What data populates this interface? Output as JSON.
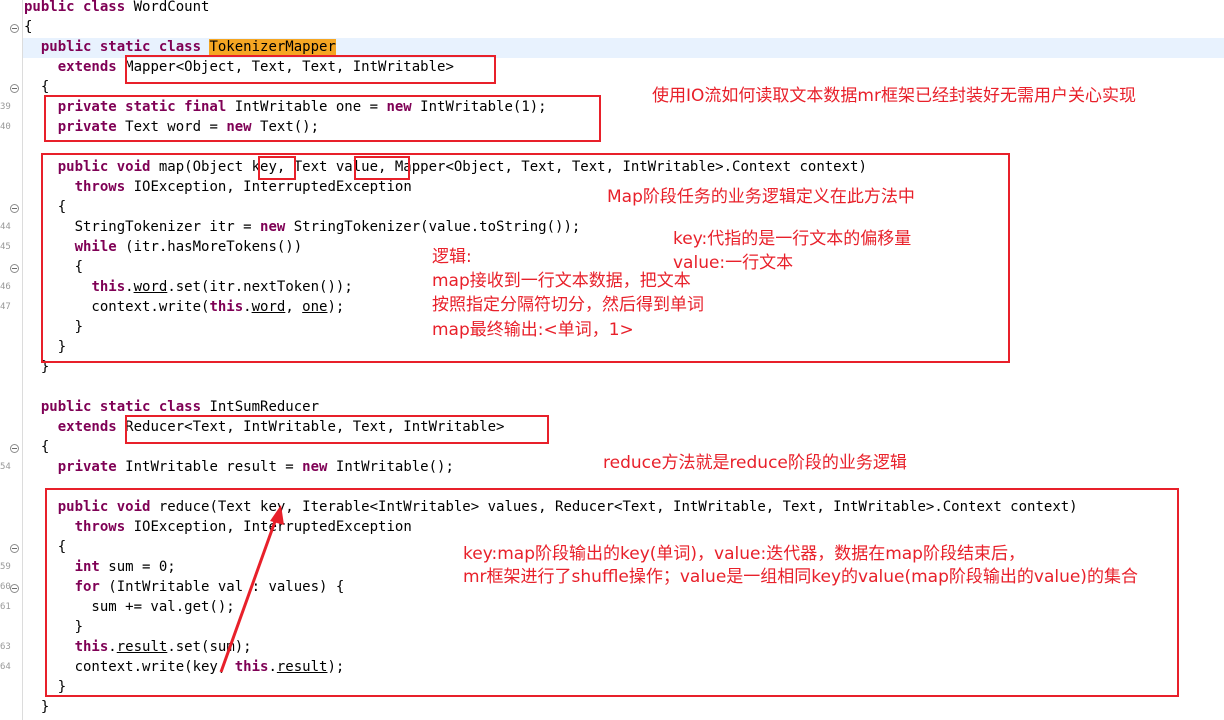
{
  "editor": {
    "highlight_color": "#f5a623",
    "annotation_color": "#e8202a",
    "line_numbers": [
      "39",
      "40",
      "44",
      "45",
      "46",
      "47",
      "54",
      "59",
      "60",
      "61",
      "63",
      "64"
    ],
    "lines": [
      {
        "id": "l1",
        "segments": [
          {
            "t": "public class ",
            "k": true
          },
          {
            "t": "WordCount"
          }
        ]
      },
      {
        "id": "l2",
        "segments": [
          {
            "t": "{"
          }
        ]
      },
      {
        "id": "l3",
        "segments": [
          {
            "t": "  "
          },
          {
            "t": "public static class ",
            "k": true
          },
          {
            "t": "TokenizerMapper",
            "m": true
          }
        ]
      },
      {
        "id": "l4",
        "segments": [
          {
            "t": "    "
          },
          {
            "t": "extends ",
            "k": true
          },
          {
            "t": "Mapper<Object, Text, Text, IntWritable>"
          }
        ]
      },
      {
        "id": "l5",
        "segments": [
          {
            "t": "  {"
          }
        ]
      },
      {
        "id": "l6",
        "segments": [
          {
            "t": "    "
          },
          {
            "t": "private static final ",
            "k": true
          },
          {
            "t": "IntWritable one = "
          },
          {
            "t": "new ",
            "k": true
          },
          {
            "t": "IntWritable(1);"
          }
        ]
      },
      {
        "id": "l7",
        "segments": [
          {
            "t": "    "
          },
          {
            "t": "private ",
            "k": true
          },
          {
            "t": "Text word = "
          },
          {
            "t": "new ",
            "k": true
          },
          {
            "t": "Text();"
          }
        ]
      },
      {
        "id": "l8",
        "segments": [
          {
            "t": ""
          }
        ]
      },
      {
        "id": "l9",
        "segments": [
          {
            "t": "    "
          },
          {
            "t": "public void ",
            "k": true
          },
          {
            "t": "map(Object key, Text value, Mapper<Object, Text, Text, IntWritable>.Context context)"
          }
        ]
      },
      {
        "id": "l10",
        "segments": [
          {
            "t": "      "
          },
          {
            "t": "throws ",
            "k": true
          },
          {
            "t": "IOException, InterruptedException"
          }
        ]
      },
      {
        "id": "l11",
        "segments": [
          {
            "t": "    {"
          }
        ]
      },
      {
        "id": "l12",
        "segments": [
          {
            "t": "      StringTokenizer itr = "
          },
          {
            "t": "new ",
            "k": true
          },
          {
            "t": "StringTokenizer(value.toString());"
          }
        ]
      },
      {
        "id": "l13",
        "segments": [
          {
            "t": "      "
          },
          {
            "t": "while ",
            "k": true
          },
          {
            "t": "(itr.hasMoreTokens())"
          }
        ]
      },
      {
        "id": "l14",
        "segments": [
          {
            "t": "      {"
          }
        ]
      },
      {
        "id": "l15",
        "segments": [
          {
            "t": "        "
          },
          {
            "t": "this",
            "k": true
          },
          {
            "t": "."
          },
          {
            "t": "word",
            "u": true
          },
          {
            "t": ".set(itr.nextToken());"
          }
        ]
      },
      {
        "id": "l16",
        "segments": [
          {
            "t": "        context.write("
          },
          {
            "t": "this",
            "k": true
          },
          {
            "t": "."
          },
          {
            "t": "word",
            "u": true
          },
          {
            "t": ", "
          },
          {
            "t": "one",
            "u": true
          },
          {
            "t": ");"
          }
        ]
      },
      {
        "id": "l17",
        "segments": [
          {
            "t": "      }"
          }
        ]
      },
      {
        "id": "l18",
        "segments": [
          {
            "t": "    }"
          }
        ]
      },
      {
        "id": "l19",
        "segments": [
          {
            "t": "  }"
          }
        ]
      },
      {
        "id": "l20",
        "segments": [
          {
            "t": ""
          }
        ]
      },
      {
        "id": "l21",
        "segments": [
          {
            "t": "  "
          },
          {
            "t": "public static class ",
            "k": true
          },
          {
            "t": "IntSumReducer"
          }
        ]
      },
      {
        "id": "l22",
        "segments": [
          {
            "t": "    "
          },
          {
            "t": "extends ",
            "k": true
          },
          {
            "t": "Reducer<Text, IntWritable, Text, IntWritable>"
          }
        ]
      },
      {
        "id": "l23",
        "segments": [
          {
            "t": "  {"
          }
        ]
      },
      {
        "id": "l24",
        "segments": [
          {
            "t": "    "
          },
          {
            "t": "private ",
            "k": true
          },
          {
            "t": "IntWritable result = "
          },
          {
            "t": "new ",
            "k": true
          },
          {
            "t": "IntWritable();"
          }
        ]
      },
      {
        "id": "l25",
        "segments": [
          {
            "t": ""
          }
        ]
      },
      {
        "id": "l26",
        "segments": [
          {
            "t": "    "
          },
          {
            "t": "public void ",
            "k": true
          },
          {
            "t": "reduce(Text key, Iterable<IntWritable> values, Reducer<Text, IntWritable, Text, IntWritable>.Context context)"
          }
        ]
      },
      {
        "id": "l27",
        "segments": [
          {
            "t": "      "
          },
          {
            "t": "throws ",
            "k": true
          },
          {
            "t": "IOException, InterruptedException"
          }
        ]
      },
      {
        "id": "l28",
        "segments": [
          {
            "t": "    {"
          }
        ]
      },
      {
        "id": "l29",
        "segments": [
          {
            "t": "      "
          },
          {
            "t": "int ",
            "k": true
          },
          {
            "t": "sum = 0;"
          }
        ]
      },
      {
        "id": "l30",
        "segments": [
          {
            "t": "      "
          },
          {
            "t": "for ",
            "k": true
          },
          {
            "t": "(IntWritable val : values) {"
          }
        ]
      },
      {
        "id": "l31",
        "segments": [
          {
            "t": "        sum += val.get();"
          }
        ]
      },
      {
        "id": "l32",
        "segments": [
          {
            "t": "      }"
          }
        ]
      },
      {
        "id": "l33",
        "segments": [
          {
            "t": "      "
          },
          {
            "t": "this",
            "k": true
          },
          {
            "t": "."
          },
          {
            "t": "result",
            "u": true
          },
          {
            "t": ".set(sum);"
          }
        ]
      },
      {
        "id": "l34",
        "segments": [
          {
            "t": "      context.write(key, "
          },
          {
            "t": "this",
            "k": true
          },
          {
            "t": "."
          },
          {
            "t": "result",
            "u": true
          },
          {
            "t": ");"
          }
        ]
      },
      {
        "id": "l35",
        "segments": [
          {
            "t": "    }"
          }
        ]
      },
      {
        "id": "l36",
        "segments": [
          {
            "t": "  }"
          }
        ]
      }
    ]
  },
  "annotations": {
    "io_note": "使用IO流如何读取文本数据mr框架已经封装好无需用户关心实现",
    "map_method_note": "Map阶段任务的业务逻辑定义在此方法中",
    "key_note": "key:代指的是一行文本的偏移量",
    "value_note": "value:一行文本",
    "logic_title": "逻辑:",
    "logic_line1": "map接收到一行文本数据，把文本",
    "logic_line2": "按照指定分隔符切分，然后得到单词",
    "logic_line3": "map最终输出:<单词，1>",
    "reduce_note": "reduce方法就是reduce阶段的业务逻辑",
    "reduce_key_line1": "key:map阶段输出的key(单词)，value:迭代器，数据在map阶段结束后，",
    "reduce_key_line2": "mr框架进行了shuffle操作；value是一组相同key的value(map阶段输出的value)的集合"
  }
}
